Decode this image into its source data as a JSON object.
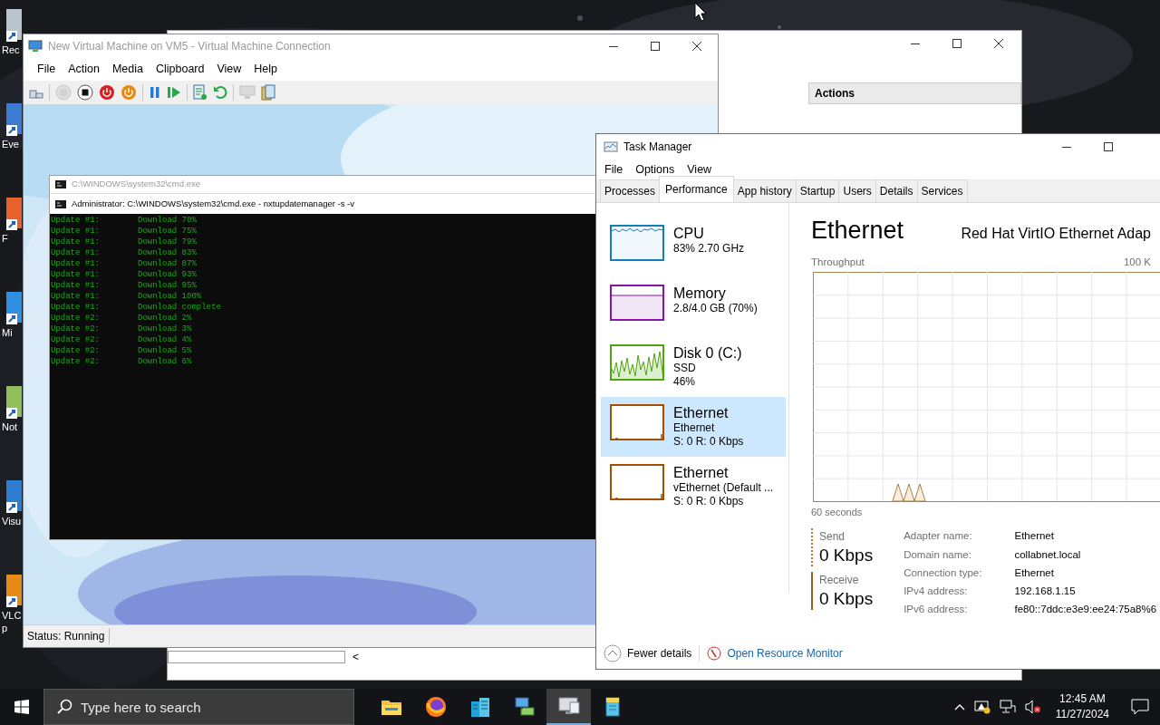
{
  "desktop_icons": [
    {
      "label": "Rec"
    },
    {
      "label": "Eve"
    },
    {
      "label": "F"
    },
    {
      "label": "Mi"
    },
    {
      "label": "Not"
    },
    {
      "label": "Visu"
    },
    {
      "label": "VLC",
      "label_2": "p"
    }
  ],
  "back_window": {
    "pane_header": "Actions",
    "scroll_arrow": "<"
  },
  "vm_window": {
    "title": "New Virtual Machine on VM5 - Virtual Machine Connection",
    "menu": [
      "File",
      "Action",
      "Media",
      "Clipboard",
      "View",
      "Help"
    ],
    "toolbar": [
      {
        "kind": "settings",
        "disabled": false
      },
      {
        "kind": "separator"
      },
      {
        "kind": "ctrl-alt-del",
        "disabled": true
      },
      {
        "kind": "stop",
        "disabled": false
      },
      {
        "kind": "power-red",
        "disabled": false
      },
      {
        "kind": "power-orange",
        "disabled": false
      },
      {
        "kind": "separator"
      },
      {
        "kind": "pause",
        "disabled": false
      },
      {
        "kind": "play",
        "disabled": false
      },
      {
        "kind": "separator"
      },
      {
        "kind": "checkpoint",
        "disabled": false
      },
      {
        "kind": "revert",
        "disabled": false
      },
      {
        "kind": "separator"
      },
      {
        "kind": "monitor",
        "disabled": true
      },
      {
        "kind": "session",
        "disabled": false
      }
    ],
    "status": "Status: Running"
  },
  "cmd": {
    "back_title": "C:\\WINDOWS\\system32\\cmd.exe",
    "title": "Administrator: C:\\WINDOWS\\system32\\cmd.exe - nxtupdatemanager  -s -v",
    "lines": [
      {
        "update": "Update #1:",
        "status": "Download 70%"
      },
      {
        "update": "Update #1:",
        "status": "Download 75%"
      },
      {
        "update": "Update #1:",
        "status": "Download 79%"
      },
      {
        "update": "Update #1:",
        "status": "Download 83%"
      },
      {
        "update": "Update #1:",
        "status": "Download 87%"
      },
      {
        "update": "Update #1:",
        "status": "Download 93%"
      },
      {
        "update": "Update #1:",
        "status": "Download 95%"
      },
      {
        "update": "Update #1:",
        "status": "Download 100%"
      },
      {
        "update": "Update #1:",
        "status": "Download complete"
      },
      {
        "update": "Update #2:",
        "status": "Download 2%"
      },
      {
        "update": "Update #2:",
        "status": "Download 3%"
      },
      {
        "update": "Update #2:",
        "status": "Download 4%"
      },
      {
        "update": "Update #2:",
        "status": "Download 5%"
      },
      {
        "update": "Update #2:",
        "status": "Download 6%"
      }
    ]
  },
  "task_manager": {
    "title": "Task Manager",
    "menu": [
      "File",
      "Options",
      "View"
    ],
    "tabs": [
      {
        "label": "Processes",
        "selected": false
      },
      {
        "label": "Performance",
        "selected": true
      },
      {
        "label": "App history",
        "selected": false
      },
      {
        "label": "Startup",
        "selected": false
      },
      {
        "label": "Users",
        "selected": false
      },
      {
        "label": "Details",
        "selected": false
      },
      {
        "label": "Services",
        "selected": false
      }
    ],
    "resources": [
      {
        "kind": "cpu",
        "name": "CPU",
        "details": [
          "83%  2.70 GHz"
        ],
        "color": "#117dbb",
        "selected": false
      },
      {
        "kind": "memory",
        "name": "Memory",
        "details": [
          "2.8/4.0 GB (70%)"
        ],
        "color": "#8b12ae",
        "selected": false
      },
      {
        "kind": "disk",
        "name": "Disk 0 (C:)",
        "details": [
          "SSD",
          "46%"
        ],
        "color": "#4da60c",
        "selected": false
      },
      {
        "kind": "ethernet",
        "name": "Ethernet",
        "details": [
          "Ethernet",
          "S: 0 R: 0 Kbps"
        ],
        "color": "#a74f01",
        "selected": true
      },
      {
        "kind": "ethernet",
        "name": "Ethernet",
        "details": [
          "vEthernet (Default ...",
          "S: 0 R: 0 Kbps"
        ],
        "color": "#a74f01",
        "selected": false
      }
    ],
    "detail": {
      "title": "Ethernet",
      "adapter": "Red Hat VirtIO Ethernet Adap",
      "graph_label": "Throughput",
      "graph_max": "100 K",
      "time_label": "60 seconds",
      "send": {
        "label": "Send",
        "value": "0 Kbps"
      },
      "receive": {
        "label": "Receive",
        "value": "0 Kbps"
      },
      "properties": [
        {
          "label": "Adapter name:",
          "value": "Ethernet"
        },
        {
          "label": "Domain name:",
          "value": "collabnet.local"
        },
        {
          "label": "Connection type:",
          "value": "Ethernet"
        },
        {
          "label": "IPv4 address:",
          "value": "192.168.1.15"
        },
        {
          "label": "IPv6 address:",
          "value": "fe80::7ddc:e3e9:ee24:75a8%6"
        }
      ]
    },
    "footer": {
      "fewer": "Fewer details",
      "monitor_link": "Open Resource Monitor"
    }
  },
  "taskbar": {
    "search_placeholder": "Type here to search",
    "apps": [
      {
        "kind": "folder",
        "active": false
      },
      {
        "kind": "browser",
        "active": false
      },
      {
        "kind": "buildings",
        "active": false
      },
      {
        "kind": "network-pc",
        "active": false
      },
      {
        "kind": "monitor",
        "active": true
      },
      {
        "kind": "server",
        "active": false
      }
    ],
    "time": "12:45 AM",
    "date": "11/27/2024"
  }
}
